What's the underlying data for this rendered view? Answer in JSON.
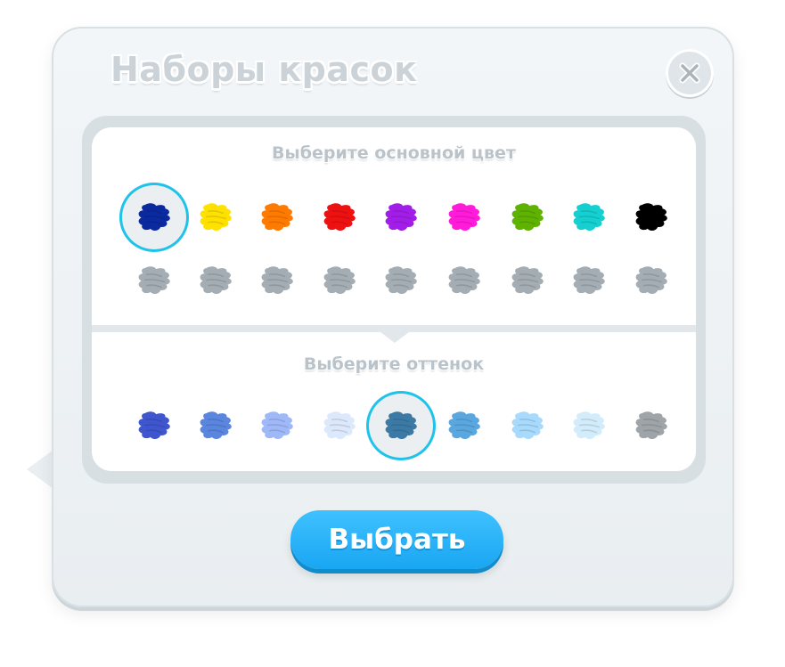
{
  "dialog": {
    "title": "Наборы красок",
    "close_icon": "close-icon",
    "base_label": "Выберите основной цвет",
    "shade_label": "Выберите оттенок",
    "select_button": "Выбрать"
  },
  "base_colors": [
    "#0b2aa0",
    "#ffe100",
    "#ff7a00",
    "#ee1111",
    "#a21ee8",
    "#ff1bd9",
    "#5fb300",
    "#15cfd0",
    "#000000"
  ],
  "locked_colors": [
    "#a4adb3",
    "#a4adb3",
    "#a4adb3",
    "#a4adb3",
    "#a4adb3",
    "#a4adb3",
    "#a4adb3",
    "#a4adb3",
    "#a4adb3"
  ],
  "shade_colors": [
    "#3f56cf",
    "#5a86df",
    "#9fb8f8",
    "#dce8fb",
    "#3c7aa6",
    "#5aa7df",
    "#a7dafc",
    "#d2ecfb",
    "#9ea4a8"
  ],
  "selected": {
    "base_index": 0,
    "shade_index": 4
  },
  "accent": "#1fc3ea",
  "button_color": "#1ba8f3"
}
